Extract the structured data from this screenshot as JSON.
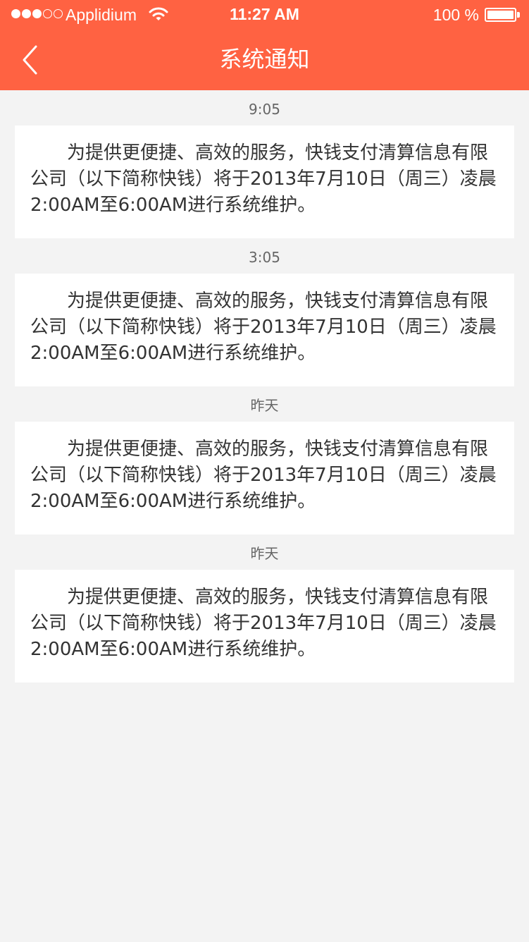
{
  "status_bar": {
    "carrier": "Applidium",
    "time": "11:27 AM",
    "battery": "100 %",
    "signal_strength": 3,
    "signal_max": 5
  },
  "nav": {
    "title": "系统通知",
    "back_icon": "chevron-left-icon"
  },
  "notifications": [
    {
      "time": "9:05",
      "message": "为提供更便捷、高效的服务，快钱支付清算信息有限公司（以下简称快钱）将于2013年7月10日（周三）凌晨 2:00AM至6:00AM进行系统维护。"
    },
    {
      "time": "3:05",
      "message": "为提供更便捷、高效的服务，快钱支付清算信息有限公司（以下简称快钱）将于2013年7月10日（周三）凌晨 2:00AM至6:00AM进行系统维护。"
    },
    {
      "time": "昨天",
      "message": "为提供更便捷、高效的服务，快钱支付清算信息有限公司（以下简称快钱）将于2013年7月10日（周三）凌晨 2:00AM至6:00AM进行系统维护。"
    },
    {
      "time": "昨天",
      "message": "为提供更便捷、高效的服务，快钱支付清算信息有限公司（以下简称快钱）将于2013年7月10日（周三）凌晨 2:00AM至6:00AM进行系统维护。"
    }
  ],
  "colors": {
    "header": "#ff6242",
    "background": "#f3f3f3",
    "card": "#ffffff",
    "text": "#333333",
    "time_label": "#666666"
  }
}
